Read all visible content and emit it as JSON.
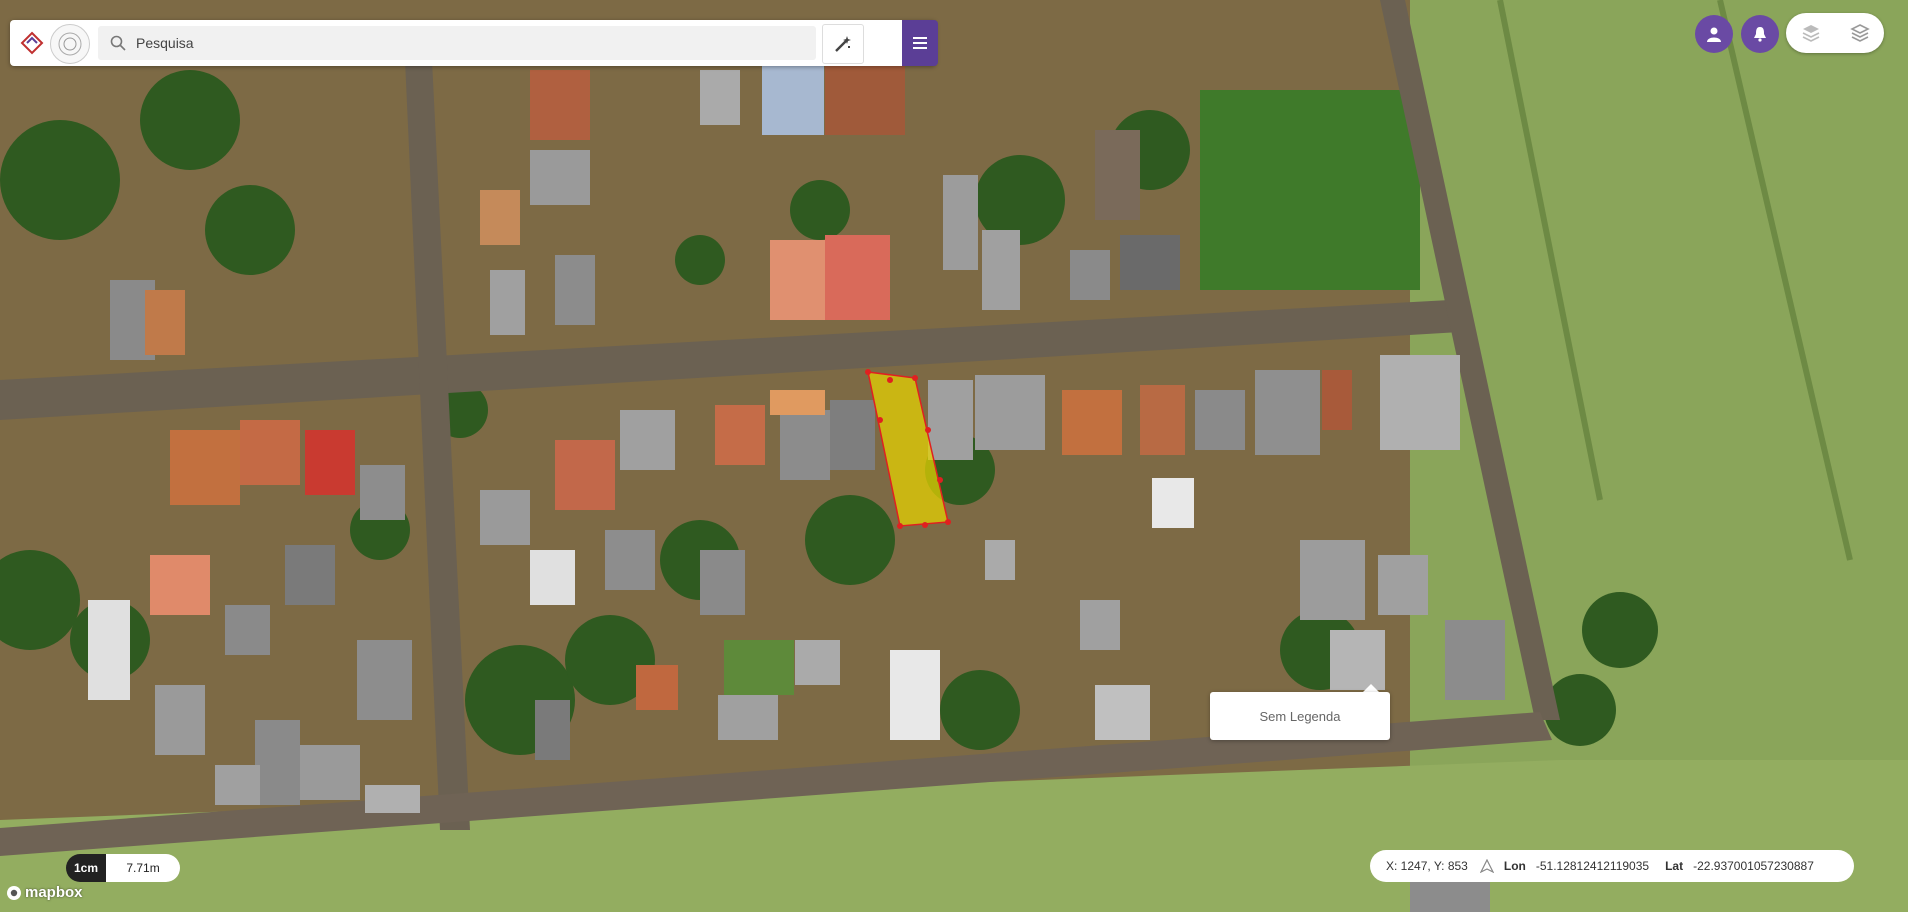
{
  "search": {
    "placeholder": "Pesquisa"
  },
  "toolbar": {
    "tool_icon": "magic-edit-icon",
    "menu_icon": "hamburger-menu-icon"
  },
  "top_right": {
    "user_icon": "user-icon",
    "bell_icon": "bell-icon",
    "layer_icons": [
      "layers-3d-icon",
      "layers-icon"
    ]
  },
  "popup": {
    "label": "Sem Legenda"
  },
  "scale": {
    "unit": "1cm",
    "distance": "7.71m"
  },
  "attribution": {
    "brand": "mapbox"
  },
  "coords": {
    "xy_label": "X: 1247, Y: 853",
    "lon_label": "Lon",
    "lon_value": "-51.12812412119035",
    "lat_label": "Lat",
    "lat_value": "-22.937001057230887"
  },
  "colors": {
    "accent": "#5b3e96",
    "selection": "#e8d400",
    "vertex": "#e02020"
  }
}
